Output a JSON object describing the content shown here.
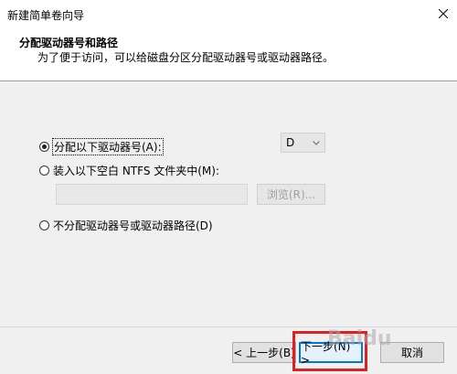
{
  "window": {
    "title": "新建简单卷向导"
  },
  "header": {
    "title": "分配驱动器号和路径",
    "subtitle": "为了便于访问，可以给磁盘分区分配驱动器号或驱动器路径。"
  },
  "options": {
    "assign_letter": {
      "label": "分配以下驱动器号(A):",
      "selected": true
    },
    "mount_folder": {
      "label": "装入以下空白 NTFS 文件夹中(M):",
      "selected": false
    },
    "no_assign": {
      "label": "不分配驱动器号或驱动器路径(D)",
      "selected": false
    }
  },
  "drive_letter": {
    "value": "D"
  },
  "folder_path": {
    "value": "",
    "browse_label": "浏览(R)..."
  },
  "footer": {
    "back_label": "< 上一步(B)",
    "next_label": "下一步(N) >",
    "cancel_label": "取消"
  },
  "watermark": {
    "text": "Baidu"
  },
  "colors": {
    "accent": "#0078d7",
    "highlight": "#e02020"
  }
}
